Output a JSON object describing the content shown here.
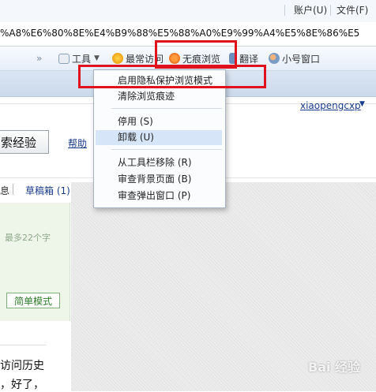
{
  "menu": {
    "account": "账户(U)",
    "file": "文件(F)"
  },
  "address": {
    "url": "%A8%E6%80%8E%E4%B9%88%E5%88%A0%E9%99%A4%E5%8E%86%E5"
  },
  "toolbar": {
    "tools": "工具",
    "recent": "最常访问",
    "no_trace": "无痕浏览",
    "translate": "翻译",
    "small_window": "小号窗口"
  },
  "dropdown": {
    "items": [
      "启用隐私保护浏览模式",
      "清除浏览痕迹",
      "停用 (S)",
      "卸载 (U)",
      "从工具栏移除 (R)",
      "审查背景页面 (B)",
      "审查弹出窗口 (P)"
    ]
  },
  "page": {
    "username": "xiaopengcxp",
    "search_button": "索经验",
    "help": "帮助",
    "tab_left": "息",
    "drafts": "草稿箱 (1)",
    "hint": "最多22个字",
    "simple_mode": "简单模式",
    "text_line1": "访问历史",
    "text_line2": "，好了，"
  },
  "watermark": "Bai 经验",
  "colors": {
    "highlight_box": "#e0121d",
    "menu_highlight": "#d6e6f8",
    "link": "#1a3c8c"
  }
}
